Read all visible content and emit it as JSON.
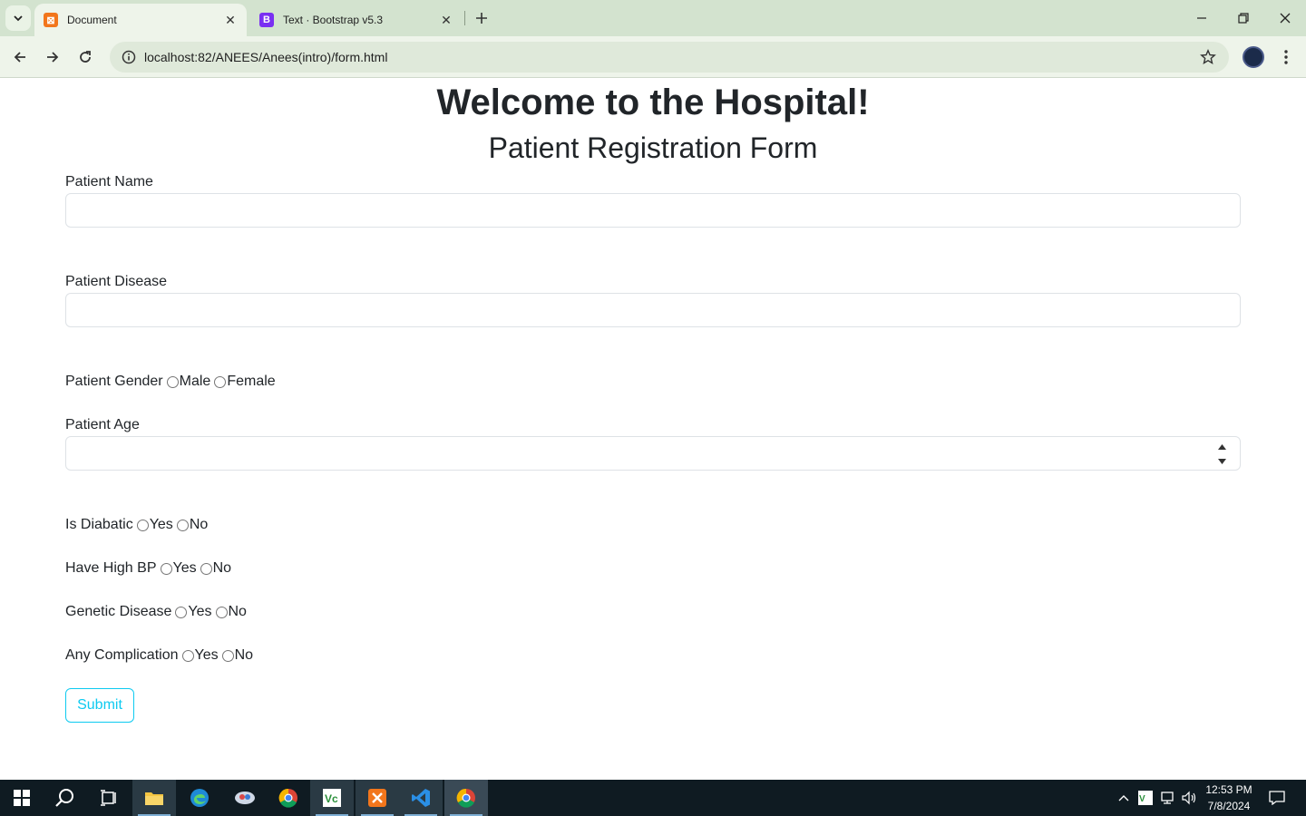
{
  "browser": {
    "tabs": [
      {
        "title": "Document",
        "favicon": "xampp-icon",
        "active": true
      },
      {
        "title": "Text · Bootstrap v5.3",
        "favicon": "bootstrap-icon",
        "active": false
      }
    ],
    "url": "localhost:82/ANEES/Anees(intro)/form.html"
  },
  "page": {
    "title": "Welcome to the Hospital!",
    "subtitle": "Patient Registration Form",
    "fields": {
      "name_label": "Patient Name",
      "disease_label": "Patient Disease",
      "age_label": "Patient Age"
    },
    "gender": {
      "label": "Patient Gender",
      "options": [
        "Male",
        "Female"
      ]
    },
    "questions": [
      {
        "label": "Is Diabatic",
        "options": [
          "Yes",
          "No"
        ]
      },
      {
        "label": "Have High BP",
        "options": [
          "Yes",
          "No"
        ]
      },
      {
        "label": "Genetic Disease",
        "options": [
          "Yes",
          "No"
        ]
      },
      {
        "label": "Any Complication",
        "options": [
          "Yes",
          "No"
        ]
      }
    ],
    "submit_label": "Submit"
  },
  "taskbar": {
    "time": "12:53 PM",
    "date": "7/8/2024"
  },
  "colors": {
    "accent": "#0dcaf0",
    "tabstrip": "#d3e3cf",
    "toolbar": "#eef4ea"
  }
}
